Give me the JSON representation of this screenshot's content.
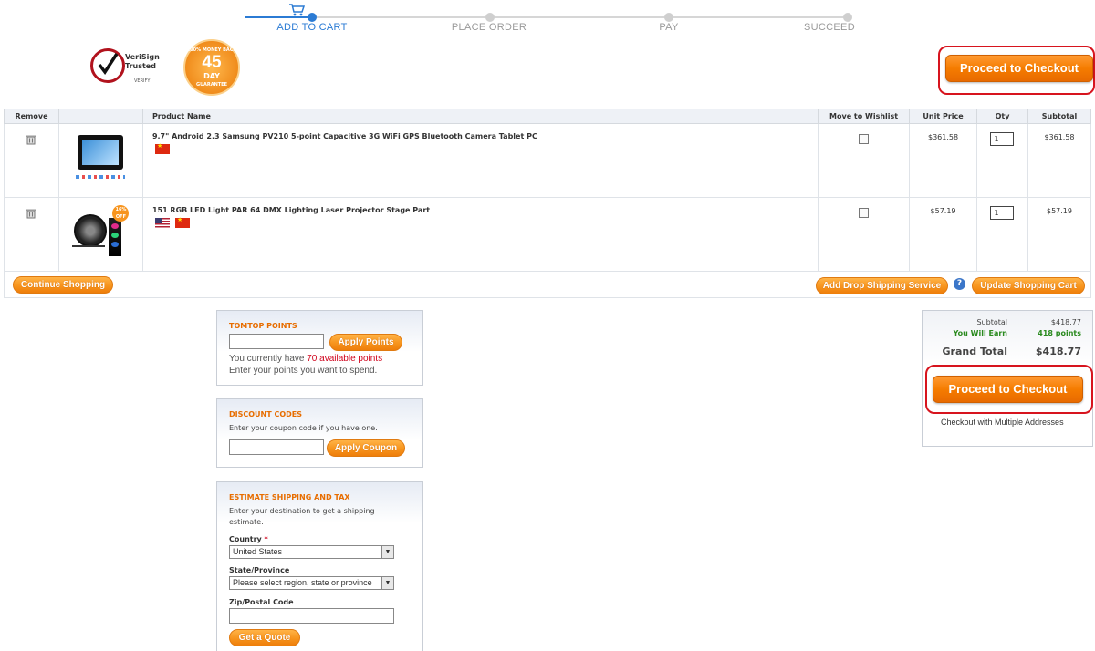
{
  "progress": {
    "steps": [
      "ADD TO CART",
      "PLACE ORDER",
      "PAY",
      "SUCCEED"
    ],
    "active_step": 0,
    "active_color": "#2b7bd4"
  },
  "badges": {
    "verisign_line1": "VeriSign",
    "verisign_line2": "Trusted",
    "verisign_verify": "VERIFY",
    "moneyback_top": "100% MONEY BACK",
    "moneyback_days": "45",
    "moneyback_day": "DAY",
    "moneyback_bottom": "GUARANTEE"
  },
  "checkout_top_label": "Proceed to Checkout",
  "cart": {
    "headers": [
      "Remove",
      "",
      "Product Name",
      "Move to Wishlist",
      "Unit Price",
      "Qty",
      "Subtotal"
    ],
    "items": [
      {
        "name": "9.7\" Android 2.3 Samsung PV210 5-point Capacitive 3G WiFi GPS Bluetooth Camera Tablet PC",
        "flags": [
          "cn-flag"
        ],
        "unit_price": "$361.58",
        "qty": "1",
        "subtotal": "$361.58"
      },
      {
        "name": "151 RGB LED Light PAR 64 DMX Lighting Laser Projector Stage Part",
        "flags": [
          "us-flag",
          "cn-flag"
        ],
        "unit_price": "$57.19",
        "qty": "1",
        "subtotal": "$57.19",
        "promo_badge": "16% OFF"
      }
    ],
    "continue_label": "Continue Shopping",
    "dropship_label": "Add Drop Shipping Service",
    "help_icon": "?",
    "update_label": "Update Shopping Cart"
  },
  "points": {
    "title": "TOMTOP POINTS",
    "input_value": "",
    "button_label": "Apply Points",
    "text_before": "You currently have ",
    "highlight": "70 available points",
    "text_line2": "Enter your points you want to spend."
  },
  "discount": {
    "title": "DISCOUNT CODES",
    "text": "Enter your coupon code if you have one.",
    "input_value": "",
    "button_label": "Apply Coupon"
  },
  "shipping": {
    "title": "ESTIMATE SHIPPING AND TAX",
    "text_line1": "Enter your destination to get a shipping",
    "text_line2": "estimate.",
    "country_label": "Country",
    "required_mark": "*",
    "country_value": "United States",
    "state_label": "State/Province",
    "state_value": "Please select region, state or province",
    "zip_label": "Zip/Postal Code",
    "zip_value": "",
    "quote_label": "Get a Quote"
  },
  "totals": {
    "subtotal_label": "Subtotal",
    "subtotal_value": "$418.77",
    "earn_label": "You Will Earn",
    "earn_value": "418 points",
    "grand_label": "Grand Total",
    "grand_value": "$418.77",
    "checkout_label": "Proceed to Checkout",
    "multi_label": "Checkout with Multiple Addresses"
  },
  "colors": {
    "accent_orange": "#f7941d",
    "earn_green": "#2a8a1e",
    "highlight_red": "#d0021b",
    "annotation_red": "#d7141e"
  }
}
